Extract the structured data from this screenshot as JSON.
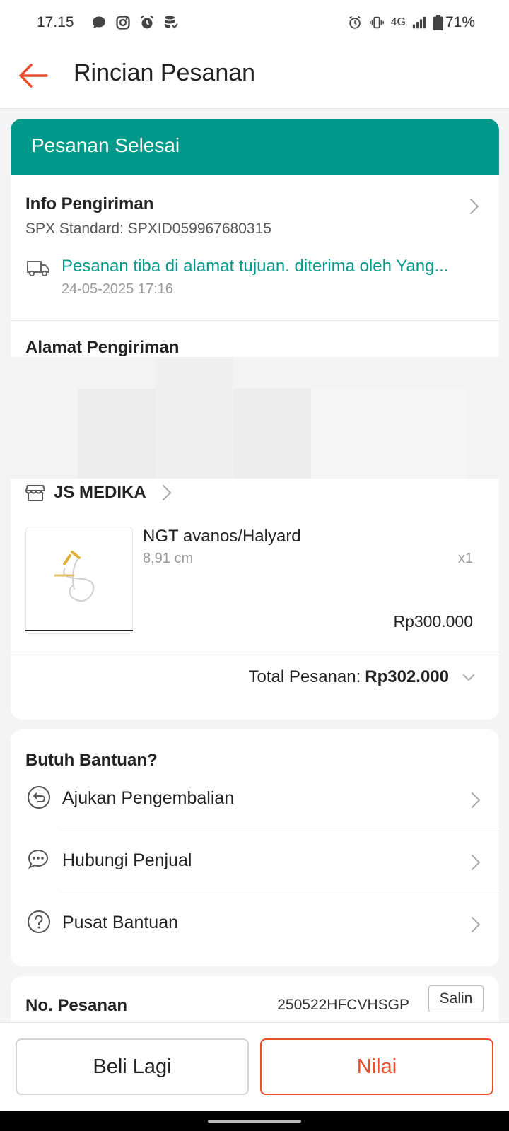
{
  "status_bar": {
    "time": "17.15",
    "network": "4G",
    "battery": "71%"
  },
  "header": {
    "title": "Rincian Pesanan"
  },
  "order_status": {
    "banner": "Pesanan Selesai"
  },
  "shipping_info": {
    "title": "Info Pengiriman",
    "courier_line": "SPX Standard: SPXID059967680315",
    "latest_status": "Pesanan tiba di alamat tujuan. diterima oleh Yang...",
    "latest_time": "24-05-2025 17:16"
  },
  "address": {
    "title": "Alamat Pengiriman"
  },
  "shop": {
    "name": "JS MEDIKA"
  },
  "product": {
    "name": "NGT avanos/Halyard",
    "variant": "8,91 cm",
    "quantity": "x1",
    "price": "Rp300.000"
  },
  "total": {
    "label": "Total Pesanan:",
    "value": "Rp302.000"
  },
  "help": {
    "title": "Butuh Bantuan?",
    "items": [
      {
        "label": "Ajukan Pengembalian",
        "icon": "return-icon"
      },
      {
        "label": "Hubungi Penjual",
        "icon": "chat-icon"
      },
      {
        "label": "Pusat Bantuan",
        "icon": "help-icon"
      }
    ]
  },
  "order_number": {
    "label": "No. Pesanan",
    "value": "250522HFCVHSGP",
    "copy_label": "Salin"
  },
  "actions": {
    "buy_again": "Beli Lagi",
    "rate": "Nilai"
  },
  "colors": {
    "brand": "#ee4d2d",
    "status_green": "#00998a"
  }
}
